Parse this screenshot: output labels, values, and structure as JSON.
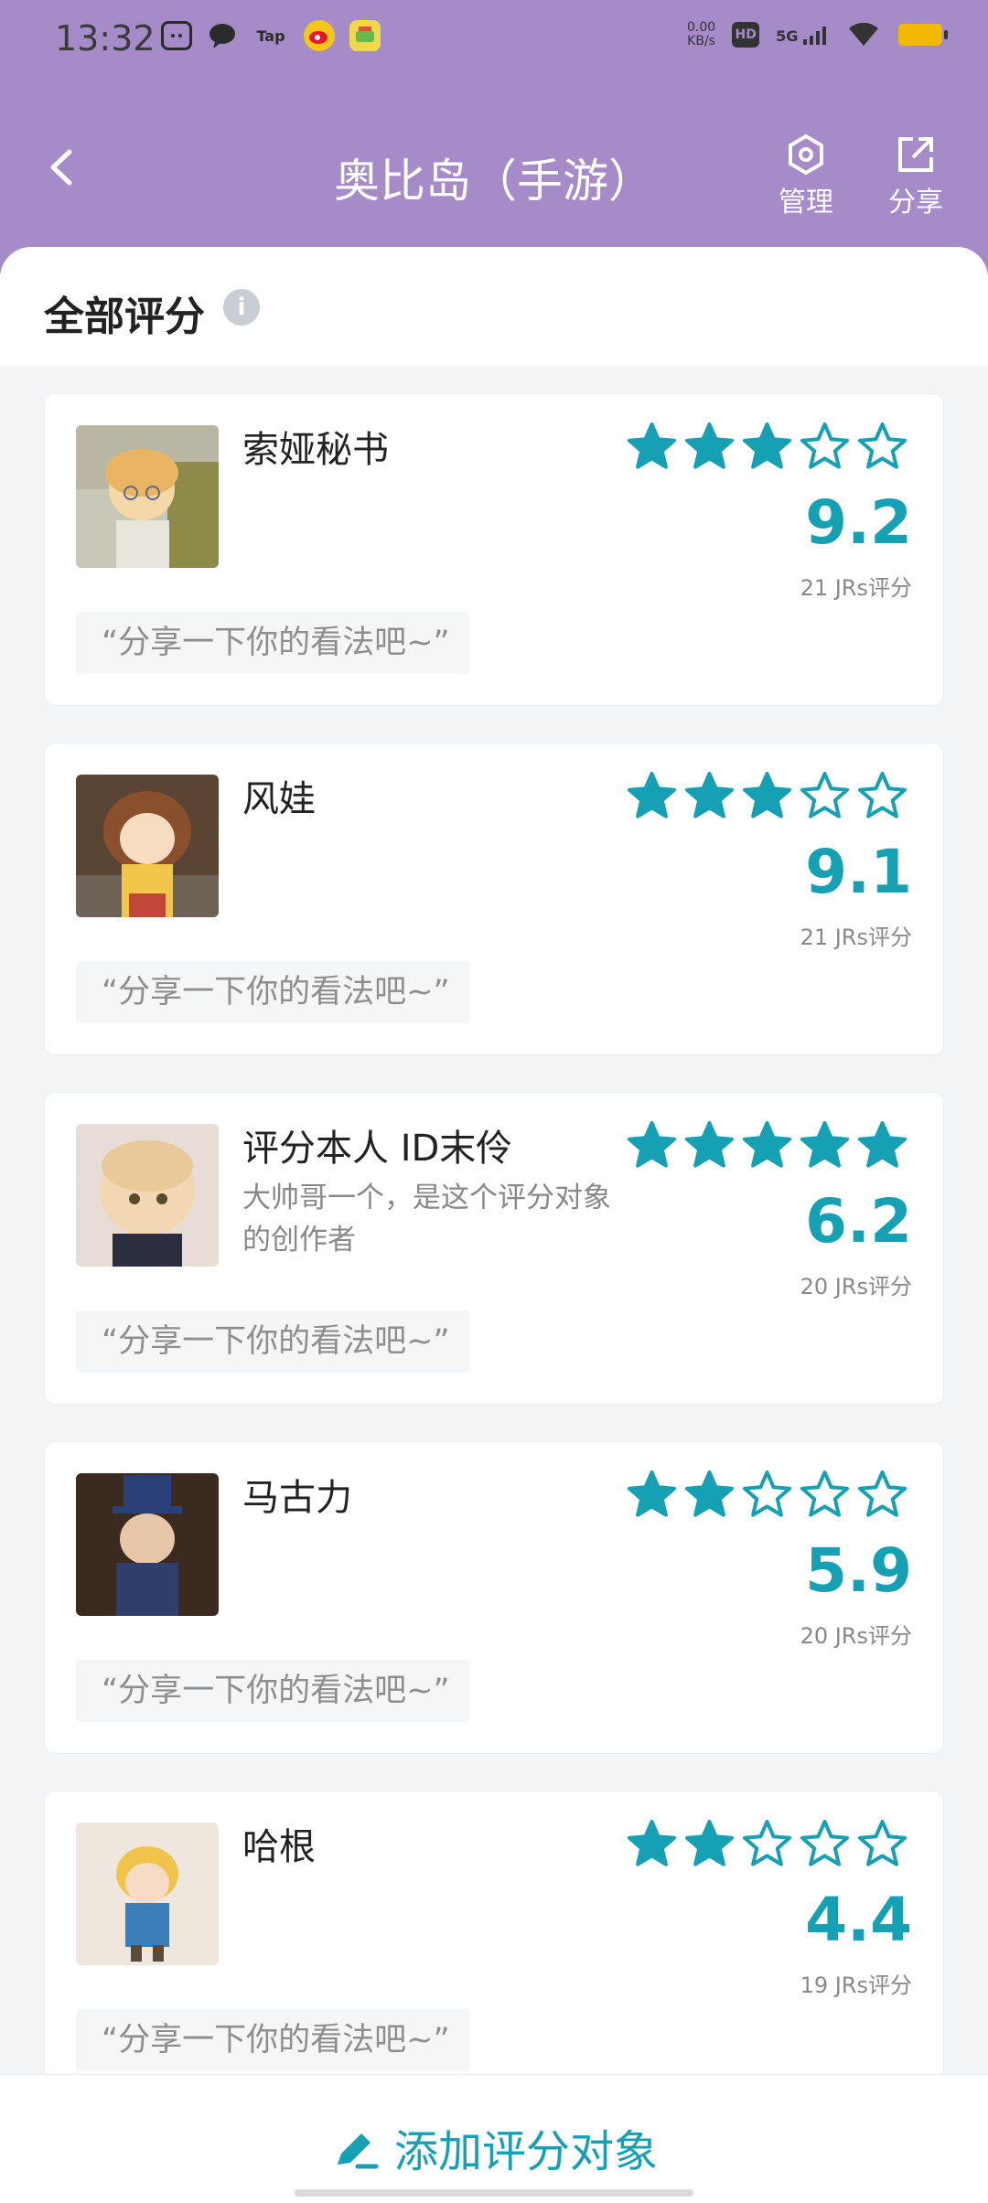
{
  "status_bar": {
    "time": "13:32",
    "notif_icons": [
      "bilibili-icon",
      "chat-bubble-icon",
      "tap-icon",
      "weibo-icon",
      "game-icon"
    ],
    "tap_label": "Tap",
    "net_speed_value": "0.00",
    "net_speed_unit": "KB/s",
    "hd_label": "HD",
    "network_label": "5G"
  },
  "nav": {
    "title": "奥比岛（手游）",
    "manage_label": "管理",
    "share_label": "分享"
  },
  "section": {
    "title": "全部评分",
    "info_icon": "info-icon"
  },
  "cards": [
    {
      "name": "索娅秘书",
      "desc": "",
      "stars": 3,
      "score": "9.2",
      "count": "21 JRs评分",
      "comment": "“分享一下你的看法吧~”"
    },
    {
      "name": "风娃",
      "desc": "",
      "stars": 3,
      "score": "9.1",
      "count": "21 JRs评分",
      "comment": "“分享一下你的看法吧~”"
    },
    {
      "name": "评分本人 ID末伶",
      "desc": "大帅哥一个，是这个评分对象的创作者",
      "stars": 5,
      "score": "6.2",
      "count": "20 JRs评分",
      "comment": "“分享一下你的看法吧~”"
    },
    {
      "name": "马古力",
      "desc": "",
      "stars": 2,
      "score": "5.9",
      "count": "20 JRs评分",
      "comment": "“分享一下你的看法吧~”"
    },
    {
      "name": "哈根",
      "desc": "",
      "stars": 2,
      "score": "4.4",
      "count": "19 JRs评分",
      "comment": "“分享一下你的看法吧~”"
    }
  ],
  "bottom": {
    "add_label": "添加评分对象"
  },
  "colors": {
    "header": "#a58bc7",
    "accent": "#16a0b4"
  }
}
